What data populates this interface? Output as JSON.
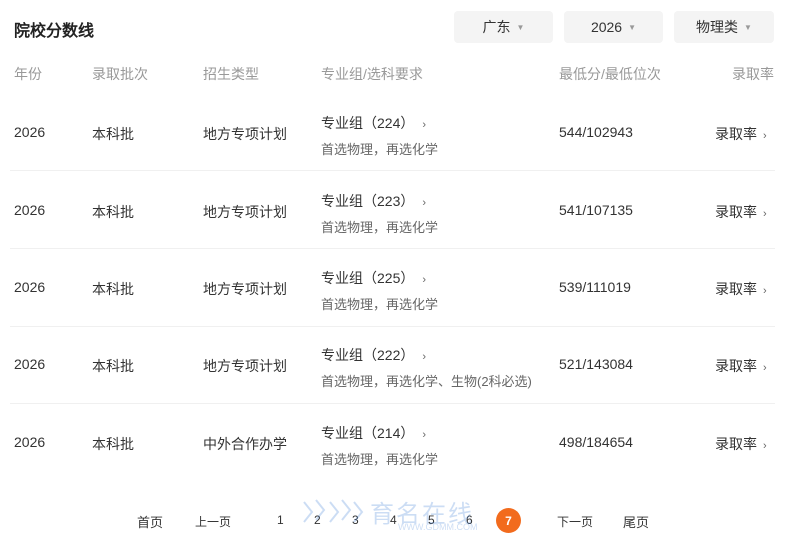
{
  "header": {
    "title": "院校分数线",
    "filters": [
      {
        "value": "广东"
      },
      {
        "value": "2026"
      },
      {
        "value": "物理类"
      }
    ]
  },
  "columns": [
    "年份",
    "录取批次",
    "招生类型",
    "专业组/选科要求",
    "最低分/最低位次",
    "录取率"
  ],
  "rows": [
    {
      "year": "2026",
      "batch": "本科批",
      "type": "地方专项计划",
      "group": "专业组（224）",
      "requirement": "首选物理，再选化学",
      "score": "544/102943",
      "rate": "录取率"
    },
    {
      "year": "2026",
      "batch": "本科批",
      "type": "地方专项计划",
      "group": "专业组（223）",
      "requirement": "首选物理，再选化学",
      "score": "541/107135",
      "rate": "录取率"
    },
    {
      "year": "2026",
      "batch": "本科批",
      "type": "地方专项计划",
      "group": "专业组（225）",
      "requirement": "首选物理，再选化学",
      "score": "539/111019",
      "rate": "录取率"
    },
    {
      "year": "2026",
      "batch": "本科批",
      "type": "地方专项计划",
      "group": "专业组（222）",
      "requirement": "首选物理，再选化学、生物(2科必选)",
      "score": "521/143084",
      "rate": "录取率"
    },
    {
      "year": "2026",
      "batch": "本科批",
      "type": "中外合作办学",
      "group": "专业组（214）",
      "requirement": "首选物理，再选化学",
      "score": "498/184654",
      "rate": "录取率"
    }
  ],
  "pagination": {
    "first": "首页",
    "prev": "上一页",
    "pages": [
      "1",
      "2",
      "3",
      "4",
      "5",
      "6"
    ],
    "current": "7",
    "next": "下一页",
    "last": "尾页"
  },
  "watermark": {
    "text": "育名在线",
    "url": "WWW.GDMM.COM"
  },
  "icons": {
    "caret": "caret-down-icon",
    "chevron": "chevron-right-icon"
  },
  "colors": {
    "accent": "#f26b1d",
    "header_text": "#999999",
    "filter_bg": "#f4f4f4"
  }
}
